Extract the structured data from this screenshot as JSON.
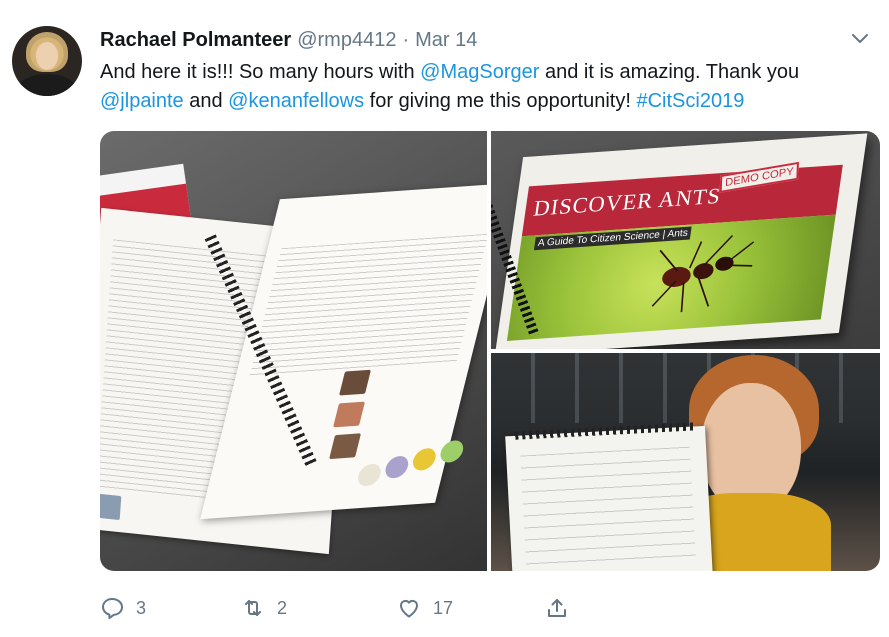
{
  "tweet": {
    "author": {
      "display_name": "Rachael Polmanteer",
      "handle": "@rmp4412",
      "separator": "·",
      "date": "Mar 14"
    },
    "text_segments": [
      {
        "text": "And here it is!!! So many hours with ",
        "type": "plain"
      },
      {
        "text": "@MagSorger",
        "type": "mention"
      },
      {
        "text": " and it is amazing. Thank you ",
        "type": "plain"
      },
      {
        "text": "@jlpainte",
        "type": "mention"
      },
      {
        "text": " and ",
        "type": "plain"
      },
      {
        "text": "@kenanfellows",
        "type": "mention"
      },
      {
        "text": " for giving me this opportunity! ",
        "type": "plain"
      },
      {
        "text": "#CitSci2019",
        "type": "hashtag"
      }
    ],
    "media": [
      {
        "icon": "photo-open-booklet"
      },
      {
        "icon": "photo-booklet-cover",
        "cover_title": "DISCOVER ANTS",
        "cover_subtitle": "A Guide To Citizen Science | Ants",
        "stamp": "DEMO COPY"
      },
      {
        "icon": "photo-woman-holding-page"
      }
    ],
    "actions": {
      "reply": {
        "icon": "reply-icon",
        "count": "3"
      },
      "retweet": {
        "icon": "retweet-icon",
        "count": "2"
      },
      "like": {
        "icon": "heart-icon",
        "count": "17"
      },
      "share": {
        "icon": "share-icon"
      }
    }
  },
  "colors": {
    "text": "#14171a",
    "muted": "#657786",
    "link": "#1b95e0",
    "action_icon": "#657786"
  }
}
